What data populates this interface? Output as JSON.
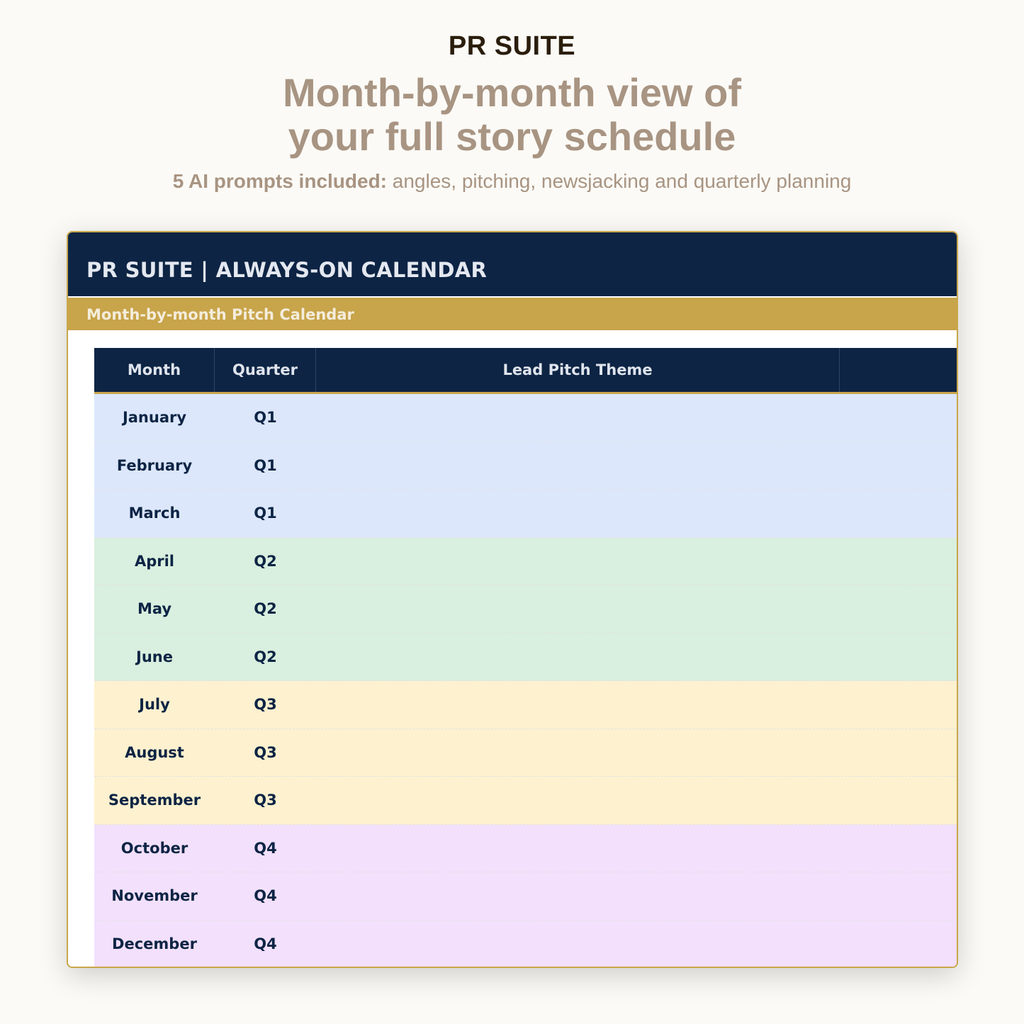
{
  "hero": {
    "brand": "PR SUITE",
    "headline_line1": "Month-by-month view of",
    "headline_line2": "your full story schedule",
    "subline_bold": "5 AI prompts included:",
    "subline_rest": " angles, pitching, newsjacking and quarterly planning"
  },
  "sheet": {
    "title": "PR SUITE | ALWAYS-ON CALENDAR",
    "subtitle": "Month-by-month Pitch Calendar",
    "columns": [
      "Month",
      "Quarter",
      "Lead Pitch Theme",
      ""
    ],
    "rows": [
      {
        "month": "January",
        "quarter": "Q1",
        "theme": "",
        "extra": ""
      },
      {
        "month": "February",
        "quarter": "Q1",
        "theme": "",
        "extra": ""
      },
      {
        "month": "March",
        "quarter": "Q1",
        "theme": "",
        "extra": ""
      },
      {
        "month": "April",
        "quarter": "Q2",
        "theme": "",
        "extra": ""
      },
      {
        "month": "May",
        "quarter": "Q2",
        "theme": "",
        "extra": ""
      },
      {
        "month": "June",
        "quarter": "Q2",
        "theme": "",
        "extra": ""
      },
      {
        "month": "July",
        "quarter": "Q3",
        "theme": "",
        "extra": ""
      },
      {
        "month": "August",
        "quarter": "Q3",
        "theme": "",
        "extra": ""
      },
      {
        "month": "September",
        "quarter": "Q3",
        "theme": "",
        "extra": ""
      },
      {
        "month": "October",
        "quarter": "Q4",
        "theme": "",
        "extra": ""
      },
      {
        "month": "November",
        "quarter": "Q4",
        "theme": "",
        "extra": ""
      },
      {
        "month": "December",
        "quarter": "Q4",
        "theme": "",
        "extra": ""
      }
    ]
  },
  "colors": {
    "navy": "#0d2444",
    "gold": "#c8a44a",
    "q1": "#dce7fc",
    "q2": "#d9efdf",
    "q3": "#fdf1cf",
    "q4": "#f2e0fc",
    "headline": "#a89482"
  }
}
